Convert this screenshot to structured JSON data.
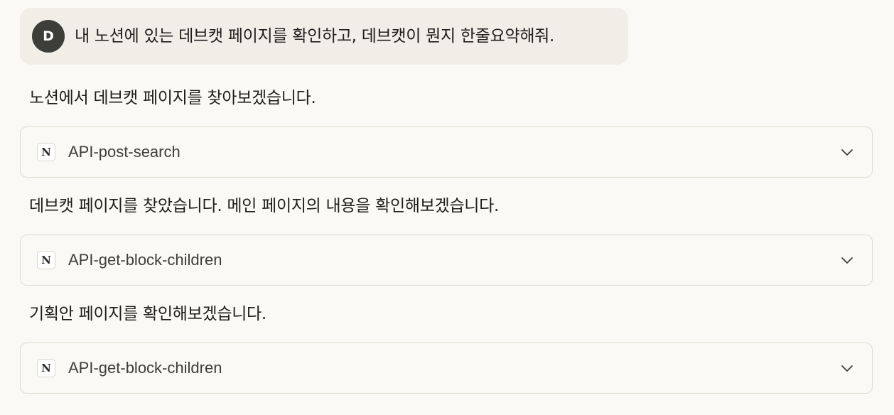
{
  "user_message": {
    "avatar_initial": "D",
    "text": "내 노션에 있는 데브캣 페이지를 확인하고, 데브캣이 뭔지 한줄요약해줘."
  },
  "assistant": {
    "messages": [
      "노션에서 데브캣 페이지를 찾아보겠습니다.",
      "데브캣 페이지를 찾았습니다. 메인 페이지의 내용을 확인해보겠습니다.",
      "기획안 페이지를 확인해보겠습니다."
    ],
    "tool_calls": [
      {
        "icon": "notion-icon",
        "icon_letter": "N",
        "name": "API-post-search"
      },
      {
        "icon": "notion-icon",
        "icon_letter": "N",
        "name": "API-get-block-children"
      },
      {
        "icon": "notion-icon",
        "icon_letter": "N",
        "name": "API-get-block-children"
      }
    ]
  },
  "colors": {
    "background": "#faf9f5",
    "user_bubble": "#f0eee6",
    "avatar": "#3d3d3a",
    "card_border": "#dedcd1"
  }
}
